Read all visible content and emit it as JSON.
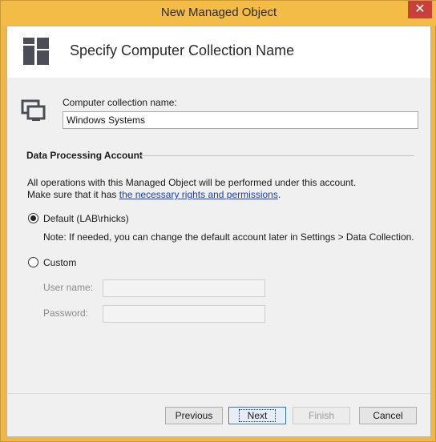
{
  "window": {
    "title": "New Managed Object",
    "close_glyph": "✕"
  },
  "header": {
    "title": "Specify Computer Collection Name",
    "icon": "layout-panels-icon"
  },
  "collection": {
    "icon": "computer-collection-icon",
    "label": "Computer collection name:",
    "value": "Windows Systems"
  },
  "account": {
    "section_title": "Data Processing Account",
    "info_line1": "All operations with this Managed Object will be performed under this account.",
    "info_line2_prefix": "Make sure that it has ",
    "info_link": "the necessary rights and permissions",
    "info_line2_suffix": ".",
    "default_label": "Default (LAB\\rhicks)",
    "default_checked": true,
    "note": "Note: If needed, you can change the default account later in Settings > Data Collection.",
    "custom_label": "Custom",
    "custom_checked": false,
    "username_label": "User name:",
    "password_label": "Password:"
  },
  "footer": {
    "previous": "Previous",
    "next": "Next",
    "finish": "Finish",
    "cancel": "Cancel"
  },
  "colors": {
    "accent_frame": "#f3bc47",
    "link": "#1a3fb8",
    "close": "#c7413a"
  }
}
